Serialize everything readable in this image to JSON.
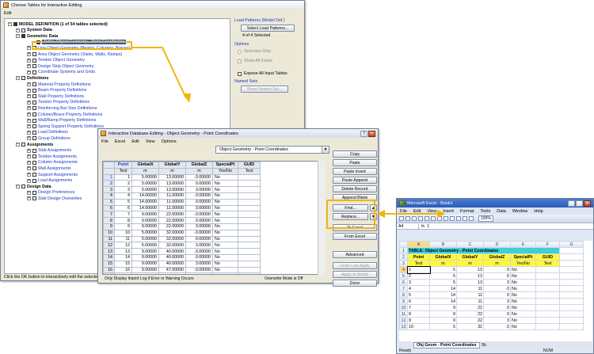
{
  "w1": {
    "title": "Choose Tables for Interactive Editing",
    "menu_edit": "Edit",
    "tree": [
      {
        "label": "MODEL DEFINITION  (1 of 54 tables selected)",
        "style": "root"
      },
      {
        "label": "System Data",
        "style": "bold"
      },
      {
        "label": "Geometric Data",
        "style": "bold"
      },
      {
        "label": "Table:  Object Geometry - Point Coordinates",
        "style": "hilite"
      },
      {
        "label": "Line Object Geometry (Beams, Columns, Braces)",
        "style": "item"
      },
      {
        "label": "Area Object Geometry (Slabs, Walls, Ramps)",
        "style": "item"
      },
      {
        "label": "Tendon Object Geometry",
        "style": "item"
      },
      {
        "label": "Design Strip Object Geometry",
        "style": "item"
      },
      {
        "label": "Coordinate Systems and Grids",
        "style": "item"
      },
      {
        "label": "Definitions",
        "style": "bold"
      },
      {
        "label": "Material Property Definitions",
        "style": "item"
      },
      {
        "label": "Beam Property Definitions",
        "style": "item"
      },
      {
        "label": "Slab Property Definitions",
        "style": "item"
      },
      {
        "label": "Tendon Property Definitions",
        "style": "item"
      },
      {
        "label": "Reinforcing Bar Size Definitions",
        "style": "item"
      },
      {
        "label": "Column/Brace Property Definitions",
        "style": "item"
      },
      {
        "label": "Wall/Ramp Property Definitions",
        "style": "item"
      },
      {
        "label": "Spring Support Property Definitions",
        "style": "item"
      },
      {
        "label": "Load Definitions",
        "style": "item"
      },
      {
        "label": "Group Definitions",
        "style": "item"
      },
      {
        "label": "Assignments",
        "style": "bold"
      },
      {
        "label": "Slab Assignments",
        "style": "item"
      },
      {
        "label": "Tendon Assignments",
        "style": "item"
      },
      {
        "label": "Column Assignments",
        "style": "item"
      },
      {
        "label": "Wall Assignments",
        "style": "item"
      },
      {
        "label": "Support Assignments",
        "style": "item"
      },
      {
        "label": "Load Assignments",
        "style": "item"
      },
      {
        "label": "Design Data",
        "style": "bold"
      },
      {
        "label": "Design Preferences",
        "style": "item"
      },
      {
        "label": "Slab Design Overwrites",
        "style": "item"
      }
    ],
    "status": "Click the OK button to interactively edit the selected",
    "load_patterns_label": "Load Patterns (Model Def.)",
    "select_load_patterns": "Select Load Patterns...",
    "selected_count": "4 of 4 Selected",
    "options_label": "Options",
    "selection_only": "Selection Only",
    "show_all_fields": "Show All Fields",
    "expose_all_input_tables": "Expose All Input Tables",
    "named_sets_label": "Named Sets",
    "show_named_set": "Show Named Set..."
  },
  "w2": {
    "title": "Interactive Database Editing - Object Geometry - Point Coordinates",
    "menu": [
      "File",
      "Excel",
      "Edit",
      "View",
      "Options"
    ],
    "combo_value": "Object Geometry - Point Coordinates",
    "headers": [
      "Point",
      "GlobalX",
      "GlobalY",
      "GlobalZ",
      "SpecialPt",
      "GUID"
    ],
    "units": [
      "Text",
      "m",
      "m",
      "m",
      "Yes/No",
      "Text"
    ],
    "rows": [
      [
        "1",
        "5.00000",
        "13.00000",
        "-3.00000",
        "No"
      ],
      [
        "2",
        "5.00000",
        "13.00000",
        "0.00000",
        "No"
      ],
      [
        "3",
        "5.00000",
        "13.00000",
        "3.00000",
        "No"
      ],
      [
        "4",
        "14.00000",
        "11.00000",
        "-3.00000",
        "No"
      ],
      [
        "5",
        "14.00000",
        "11.00000",
        "0.00000",
        "No"
      ],
      [
        "6",
        "14.00000",
        "11.00000",
        "3.00000",
        "No"
      ],
      [
        "7",
        "9.00000",
        "22.00000",
        "-3.00000",
        "No"
      ],
      [
        "8",
        "9.00000",
        "22.00000",
        "0.00000",
        "No"
      ],
      [
        "9",
        "9.00000",
        "22.00000",
        "3.00000",
        "No"
      ],
      [
        "10",
        "5.00000",
        "32.00000",
        "-3.00000",
        "No"
      ],
      [
        "11",
        "5.00000",
        "32.00000",
        "0.00000",
        "No"
      ],
      [
        "12",
        "5.00000",
        "32.00000",
        "3.00000",
        "No"
      ],
      [
        "13",
        "9.00000",
        "40.00000",
        "-3.00000",
        "No"
      ],
      [
        "14",
        "9.00000",
        "40.00000",
        "0.00000",
        "No"
      ],
      [
        "15",
        "9.00000",
        "40.00000",
        "3.00000",
        "No"
      ],
      [
        "16",
        "9.00000",
        "47.00000",
        "-3.00000",
        "No"
      ],
      [
        "17",
        "9.00000",
        "47.00000",
        "0.00000",
        "No"
      ]
    ],
    "buttons": {
      "copy": "Copy",
      "paste": "Paste",
      "paste_insert": "Paste Insert",
      "paste_append": "Paste Append",
      "delete_record": "Delete Record",
      "append_blank": "Append Blank",
      "find": "Find...",
      "replace": "Replace...",
      "to_excel": "To Excel",
      "from_excel": "From Excel",
      "advanced": "Advanced",
      "undo_last_apply": "Undo Last Apply",
      "apply_to_model": "Apply to Model",
      "done": "Done"
    },
    "foot_left": "Only Display Import Log if Error or Warning Occurs",
    "foot_right": "Overwrite Mode is Off"
  },
  "w3": {
    "title": "Microsoft Excel - Book1",
    "menu": [
      "File",
      "Edit",
      "View",
      "Insert",
      "Format",
      "Tools",
      "Data",
      "Window",
      "Help"
    ],
    "help_box": "Type a question for help",
    "name_box": "A4",
    "fx": "fx",
    "formula_value": "1",
    "zoom": "100%",
    "col_headers": [
      "A",
      "B",
      "C",
      "D",
      "E",
      "F",
      "G"
    ],
    "table_title": "TABLE:  Object Geometry - Point Coordinates",
    "headers": [
      "Point",
      "GlobalX",
      "GlobalY",
      "GlobalZ",
      "SpecialPt",
      "GUID"
    ],
    "units": [
      "Text",
      "m",
      "m",
      "m",
      "Yes/No",
      "Text"
    ],
    "rows": [
      [
        "1",
        "5",
        "13",
        "-3",
        "No"
      ],
      [
        "2",
        "5",
        "13",
        "0",
        "No"
      ],
      [
        "3",
        "5",
        "13",
        "3",
        "No"
      ],
      [
        "4",
        "14",
        "11",
        "-3",
        "No"
      ],
      [
        "5",
        "14",
        "11",
        "0",
        "No"
      ],
      [
        "6",
        "14",
        "11",
        "3",
        "No"
      ],
      [
        "7",
        "9",
        "22",
        "-3",
        "No"
      ],
      [
        "8",
        "9",
        "22",
        "0",
        "No"
      ],
      [
        "9",
        "9",
        "22",
        "3",
        "No"
      ],
      [
        "10",
        "5",
        "32",
        "-3",
        "No"
      ]
    ],
    "sheet_tab": "Obj Geom - Point Coordinates",
    "sheet_tab_more": "Sh",
    "status_left": "Ready",
    "status_right": "NUM"
  }
}
